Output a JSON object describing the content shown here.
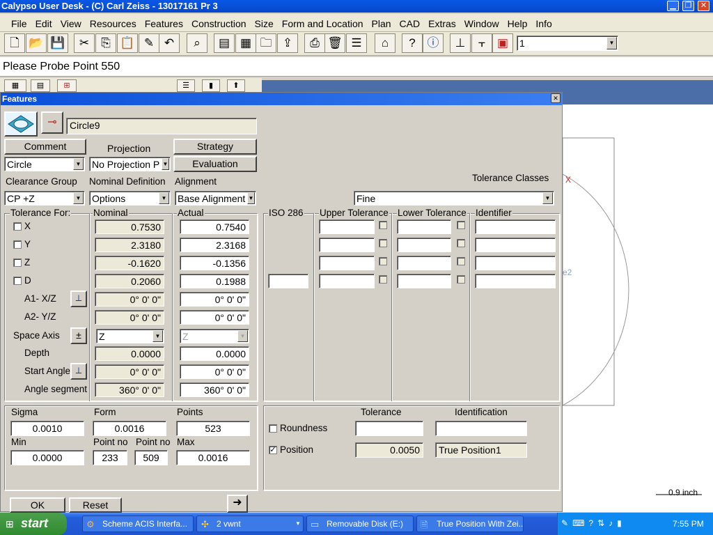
{
  "window": {
    "title": "Calypso User Desk - (C) Carl Zeiss - 13017161 Pr 3"
  },
  "menu": [
    "File",
    "Edit",
    "View",
    "Resources",
    "Features",
    "Construction",
    "Size",
    "Form and Location",
    "Plan",
    "CAD",
    "Extras",
    "Window",
    "Help",
    "Info"
  ],
  "toolbar": {
    "combo_value": "1"
  },
  "status": {
    "prompt": "Please Probe Point 550"
  },
  "cad": {
    "scale_label": "0.9 inch",
    "axis_mark": "X",
    "plane_label": "e2"
  },
  "dialog": {
    "title": "Features",
    "feature_name": "Circle9",
    "buttons": {
      "comment": "Comment",
      "strategy": "Strategy",
      "evaluation": "Evaluation",
      "ok": "OK",
      "reset": "Reset"
    },
    "labels": {
      "projection": "Projection",
      "clearance_group": "Clearance Group",
      "nominal_definition": "Nominal Definition",
      "alignment": "Alignment",
      "tolerance_classes": "Tolerance Classes",
      "tolerance_for": "Tolerance For:",
      "nominal": "Nominal",
      "actual": "Actual",
      "iso286": "ISO 286",
      "upper_tolerance": "Upper Tolerance",
      "lower_tolerance": "Lower Tolerance",
      "identifier": "Identifier"
    },
    "selects": {
      "feature_type": "Circle",
      "projection": "No Projection P",
      "clearance_group": "CP +Z",
      "nominal_definition": "Options",
      "alignment": "Base Alignment",
      "tolerance_class": "Fine"
    },
    "coords": [
      {
        "label": "X",
        "nominal": "0.7530",
        "actual": "0.7540"
      },
      {
        "label": "Y",
        "nominal": "2.3180",
        "actual": "2.3168"
      },
      {
        "label": "Z",
        "nominal": "-0.1620",
        "actual": "-0.1356"
      },
      {
        "label": "D",
        "nominal": "0.2060",
        "actual": "0.1988"
      }
    ],
    "angles": [
      {
        "label": "A1- X/Z",
        "nominal": "0° 0' 0\"",
        "actual": "0° 0' 0\""
      },
      {
        "label": "A2- Y/Z",
        "nominal": "0° 0' 0\"",
        "actual": "0° 0' 0\""
      }
    ],
    "space_axis": {
      "label": "Space Axis",
      "toggle": "±",
      "nominal": "Z",
      "actual": "Z"
    },
    "depth": {
      "label": "Depth",
      "nominal": "0.0000",
      "actual": "0.0000"
    },
    "start_angle": {
      "label": "Start Angle",
      "nominal": "0° 0' 0\"",
      "actual": "0° 0' 0\""
    },
    "angle_segment": {
      "label": "Angle segment",
      "nominal": "360° 0' 0\"",
      "actual": "360° 0' 0\""
    },
    "stats": {
      "sigma_label": "Sigma",
      "sigma": "0.0010",
      "form_label": "Form",
      "form": "0.0016",
      "points_label": "Points",
      "points": "523",
      "min_label": "Min",
      "min": "0.0000",
      "pointno_min_label": "Point no",
      "pointno_min": "233",
      "pointno_max_label": "Point no",
      "pointno_max": "509",
      "max_label": "Max",
      "max": "0.0016"
    },
    "characteristics": {
      "tolerance_label": "Tolerance",
      "identification_label": "Identification",
      "roundness_label": "Roundness",
      "roundness_tol": "",
      "roundness_id": "",
      "position_label": "Position",
      "position_tol": "0.0050",
      "position_id": "True Position1"
    }
  },
  "taskbar": {
    "start": "start",
    "tasks": [
      "Scheme ACIS Interfa...",
      "2 vwnt",
      "Removable Disk (E:)",
      "True Position With Zei..."
    ],
    "clock": "7:55 PM"
  }
}
